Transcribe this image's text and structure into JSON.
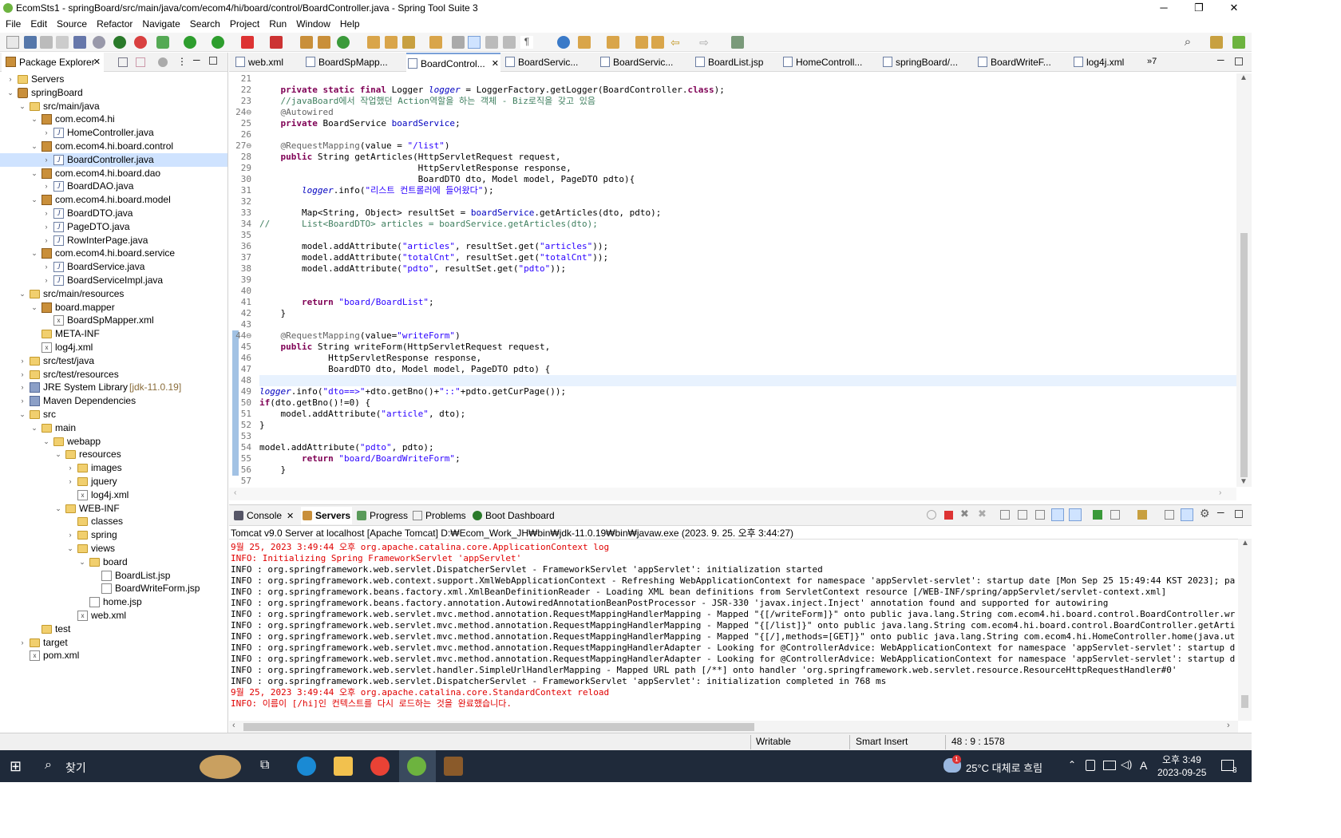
{
  "window": {
    "title": "EcomSts1 - springBoard/src/main/java/com/ecom4/hi/board/control/BoardController.java - Spring Tool Suite 3",
    "minimize": "─",
    "maximize": "❐",
    "close": "✕"
  },
  "menu": [
    "File",
    "Edit",
    "Source",
    "Refactor",
    "Navigate",
    "Search",
    "Project",
    "Run",
    "Window",
    "Help"
  ],
  "package_explorer": {
    "tab_label": "Package Explorer",
    "items": [
      {
        "label": "Servers",
        "icon": "folder",
        "depth": 0,
        "arrow": "›"
      },
      {
        "label": "springBoard",
        "icon": "project",
        "depth": 0,
        "arrow": "⌄"
      },
      {
        "label": "src/main/java",
        "icon": "source-folder",
        "depth": 1,
        "arrow": "⌄"
      },
      {
        "label": "com.ecom4.hi",
        "icon": "package",
        "depth": 2,
        "arrow": "⌄"
      },
      {
        "label": "HomeController.java",
        "icon": "java-file",
        "depth": 3,
        "arrow": "›"
      },
      {
        "label": "com.ecom4.hi.board.control",
        "icon": "package",
        "depth": 2,
        "arrow": "⌄"
      },
      {
        "label": "BoardController.java",
        "icon": "java-file",
        "depth": 3,
        "arrow": "›",
        "selected": true
      },
      {
        "label": "com.ecom4.hi.board.dao",
        "icon": "package",
        "depth": 2,
        "arrow": "⌄"
      },
      {
        "label": "BoardDAO.java",
        "icon": "java-file",
        "depth": 3,
        "arrow": "›"
      },
      {
        "label": "com.ecom4.hi.board.model",
        "icon": "package",
        "depth": 2,
        "arrow": "⌄"
      },
      {
        "label": "BoardDTO.java",
        "icon": "java-file",
        "depth": 3,
        "arrow": "›"
      },
      {
        "label": "PageDTO.java",
        "icon": "java-file",
        "depth": 3,
        "arrow": "›"
      },
      {
        "label": "RowInterPage.java",
        "icon": "java-file",
        "depth": 3,
        "arrow": "›"
      },
      {
        "label": "com.ecom4.hi.board.service",
        "icon": "package",
        "depth": 2,
        "arrow": "⌄"
      },
      {
        "label": "BoardService.java",
        "icon": "java-file",
        "depth": 3,
        "arrow": "›"
      },
      {
        "label": "BoardServiceImpl.java",
        "icon": "java-file",
        "depth": 3,
        "arrow": "›"
      },
      {
        "label": "src/main/resources",
        "icon": "source-folder",
        "depth": 1,
        "arrow": "⌄"
      },
      {
        "label": "board.mapper",
        "icon": "package",
        "depth": 2,
        "arrow": "⌄"
      },
      {
        "label": "BoardSpMapper.xml",
        "icon": "xml-file",
        "depth": 3,
        "arrow": ""
      },
      {
        "label": "META-INF",
        "icon": "folder",
        "depth": 2,
        "arrow": ""
      },
      {
        "label": "log4j.xml",
        "icon": "xml-file",
        "depth": 2,
        "arrow": ""
      },
      {
        "label": "src/test/java",
        "icon": "source-folder",
        "depth": 1,
        "arrow": "›"
      },
      {
        "label": "src/test/resources",
        "icon": "source-folder",
        "depth": 1,
        "arrow": "›"
      },
      {
        "label": "JRE System Library",
        "suffix": "[jdk-11.0.19]",
        "icon": "library",
        "depth": 1,
        "arrow": "›"
      },
      {
        "label": "Maven Dependencies",
        "icon": "library",
        "depth": 1,
        "arrow": "›"
      },
      {
        "label": "src",
        "icon": "folder",
        "depth": 1,
        "arrow": "⌄"
      },
      {
        "label": "main",
        "icon": "folder",
        "depth": 2,
        "arrow": "⌄"
      },
      {
        "label": "webapp",
        "icon": "folder",
        "depth": 3,
        "arrow": "⌄"
      },
      {
        "label": "resources",
        "icon": "folder",
        "depth": 4,
        "arrow": "⌄"
      },
      {
        "label": "images",
        "icon": "folder",
        "depth": 5,
        "arrow": "›"
      },
      {
        "label": "jquery",
        "icon": "folder",
        "depth": 5,
        "arrow": "›"
      },
      {
        "label": "log4j.xml",
        "icon": "xml-file",
        "depth": 5,
        "arrow": ""
      },
      {
        "label": "WEB-INF",
        "icon": "folder",
        "depth": 4,
        "arrow": "⌄"
      },
      {
        "label": "classes",
        "icon": "folder",
        "depth": 5,
        "arrow": ""
      },
      {
        "label": "spring",
        "icon": "folder",
        "depth": 5,
        "arrow": "›"
      },
      {
        "label": "views",
        "icon": "folder",
        "depth": 5,
        "arrow": "⌄"
      },
      {
        "label": "board",
        "icon": "folder",
        "depth": 6,
        "arrow": "⌄"
      },
      {
        "label": "BoardList.jsp",
        "icon": "jsp-file",
        "depth": 7,
        "arrow": ""
      },
      {
        "label": "BoardWriteForm.jsp",
        "icon": "jsp-file",
        "depth": 7,
        "arrow": ""
      },
      {
        "label": "home.jsp",
        "icon": "jsp-file",
        "depth": 6,
        "arrow": ""
      },
      {
        "label": "web.xml",
        "icon": "xml-file",
        "depth": 5,
        "arrow": ""
      },
      {
        "label": "test",
        "icon": "folder",
        "depth": 2,
        "arrow": ""
      },
      {
        "label": "target",
        "icon": "folder",
        "depth": 1,
        "arrow": "›"
      },
      {
        "label": "pom.xml",
        "icon": "xml-file",
        "depth": 1,
        "arrow": ""
      }
    ]
  },
  "editor": {
    "tabs": [
      {
        "label": "web.xml"
      },
      {
        "label": "BoardSpMapp..."
      },
      {
        "label": "BoardControl...",
        "active": true
      },
      {
        "label": "BoardServic..."
      },
      {
        "label": "BoardServic..."
      },
      {
        "label": "BoardList.jsp"
      },
      {
        "label": "HomeControll..."
      },
      {
        "label": "springBoard/..."
      },
      {
        "label": "BoardWriteF..."
      },
      {
        "label": "log4j.xml"
      }
    ],
    "overflow": "»7",
    "lines": [
      {
        "n": "21",
        "t": ""
      },
      {
        "n": "22",
        "t": "    private static final Logger logger = LoggerFactory.getLogger(BoardController.class);"
      },
      {
        "n": "23",
        "t": "    //javaBoard에서 작업했던 Action역할을 하는 객체 - Biz로직을 갖고 있음"
      },
      {
        "n": "24⊖",
        "t": "    @Autowired"
      },
      {
        "n": "25",
        "t": "    private BoardService boardService;"
      },
      {
        "n": "26",
        "t": ""
      },
      {
        "n": "27⊖",
        "t": "    @RequestMapping(value = \"/list\")"
      },
      {
        "n": "28",
        "t": "    public String getArticles(HttpServletRequest request,"
      },
      {
        "n": "29",
        "t": "                              HttpServletResponse response,"
      },
      {
        "n": "30",
        "t": "                              BoardDTO dto, Model model, PageDTO pdto){"
      },
      {
        "n": "31",
        "t": "        logger.info(\"리스트 컨트롤러에 들어왔다\");"
      },
      {
        "n": "32",
        "t": ""
      },
      {
        "n": "33",
        "t": "        Map<String, Object> resultSet = boardService.getArticles(dto, pdto);"
      },
      {
        "n": "34",
        "t": "//      List<BoardDTO> articles = boardService.getArticles(dto);"
      },
      {
        "n": "35",
        "t": ""
      },
      {
        "n": "36",
        "t": "        model.addAttribute(\"articles\", resultSet.get(\"articles\"));"
      },
      {
        "n": "37",
        "t": "        model.addAttribute(\"totalCnt\", resultSet.get(\"totalCnt\"));"
      },
      {
        "n": "38",
        "t": "        model.addAttribute(\"pdto\", resultSet.get(\"pdto\"));"
      },
      {
        "n": "39",
        "t": ""
      },
      {
        "n": "40",
        "t": ""
      },
      {
        "n": "41",
        "t": "        return \"board/BoardList\";"
      },
      {
        "n": "42",
        "t": "    }"
      },
      {
        "n": "43",
        "t": ""
      },
      {
        "n": "44⊖",
        "t": "    @RequestMapping(value=\"writeForm\")"
      },
      {
        "n": "45",
        "t": "    public String writeForm(HttpServletRequest request,"
      },
      {
        "n": "46",
        "t": "             HttpServletResponse response,"
      },
      {
        "n": "47",
        "t": "             BoardDTO dto, Model model, PageDTO pdto) {"
      },
      {
        "n": "48",
        "t": ""
      },
      {
        "n": "49",
        "t": "logger.info(\"dto==>\"+dto.getBno()+\"::\"+pdto.getCurPage());"
      },
      {
        "n": "50",
        "t": "if(dto.getBno()!=0) {"
      },
      {
        "n": "51",
        "t": "    model.addAttribute(\"article\", dto);"
      },
      {
        "n": "52",
        "t": "}"
      },
      {
        "n": "53",
        "t": ""
      },
      {
        "n": "54",
        "t": "model.addAttribute(\"pdto\", pdto);"
      },
      {
        "n": "55",
        "t": "        return \"board/BoardWriteForm\";"
      },
      {
        "n": "56",
        "t": "    }"
      },
      {
        "n": "57",
        "t": ""
      }
    ]
  },
  "bottom": {
    "tabs": [
      {
        "label": "Console"
      },
      {
        "label": "Servers",
        "active": true
      },
      {
        "label": "Progress"
      },
      {
        "label": "Problems"
      },
      {
        "label": "Boot Dashboard"
      }
    ],
    "launch": "Tomcat v9.0 Server at localhost [Apache Tomcat] D:₩Ecom_Work_JH₩bin₩jdk-11.0.19₩bin₩javaw.exe  (2023. 9. 25. 오후 3:44:27)",
    "console": [
      {
        "t": "9월 25, 2023 3:49:44 오후 org.apache.catalina.core.ApplicationContext log",
        "red": true
      },
      {
        "t": "INFO: Initializing Spring FrameworkServlet 'appServlet'",
        "red": true
      },
      {
        "t": "INFO : org.springframework.web.servlet.DispatcherServlet - FrameworkServlet 'appServlet': initialization started",
        "red": false
      },
      {
        "t": "INFO : org.springframework.web.context.support.XmlWebApplicationContext - Refreshing WebApplicationContext for namespace 'appServlet-servlet': startup date [Mon Sep 25 15:49:44 KST 2023]; paren",
        "red": false
      },
      {
        "t": "INFO : org.springframework.beans.factory.xml.XmlBeanDefinitionReader - Loading XML bean definitions from ServletContext resource [/WEB-INF/spring/appServlet/servlet-context.xml]",
        "red": false
      },
      {
        "t": "INFO : org.springframework.beans.factory.annotation.AutowiredAnnotationBeanPostProcessor - JSR-330 'javax.inject.Inject' annotation found and supported for autowiring",
        "red": false
      },
      {
        "t": "INFO : org.springframework.web.servlet.mvc.method.annotation.RequestMappingHandlerMapping - Mapped \"{[/writeForm]}\" onto public java.lang.String com.ecom4.hi.board.control.BoardController.write",
        "red": false
      },
      {
        "t": "INFO : org.springframework.web.servlet.mvc.method.annotation.RequestMappingHandlerMapping - Mapped \"{[/list]}\" onto public java.lang.String com.ecom4.hi.board.control.BoardController.getArticle",
        "red": false
      },
      {
        "t": "INFO : org.springframework.web.servlet.mvc.method.annotation.RequestMappingHandlerMapping - Mapped \"{[/],methods=[GET]}\" onto public java.lang.String com.ecom4.hi.HomeController.home(java.util.",
        "red": false
      },
      {
        "t": "INFO : org.springframework.web.servlet.mvc.method.annotation.RequestMappingHandlerAdapter - Looking for @ControllerAdvice: WebApplicationContext for namespace 'appServlet-servlet': startup date",
        "red": false
      },
      {
        "t": "INFO : org.springframework.web.servlet.mvc.method.annotation.RequestMappingHandlerAdapter - Looking for @ControllerAdvice: WebApplicationContext for namespace 'appServlet-servlet': startup date",
        "red": false
      },
      {
        "t": "INFO : org.springframework.web.servlet.handler.SimpleUrlHandlerMapping - Mapped URL path [/**] onto handler 'org.springframework.web.servlet.resource.ResourceHttpRequestHandler#0'",
        "red": false
      },
      {
        "t": "INFO : org.springframework.web.servlet.DispatcherServlet - FrameworkServlet 'appServlet': initialization completed in 768 ms",
        "red": false
      },
      {
        "t": "9월 25, 2023 3:49:44 오후 org.apache.catalina.core.StandardContext reload",
        "red": true
      },
      {
        "t": "INFO: 이름이 [/hi]인 컨텍스트를 다시 로드하는 것을 완료했습니다.",
        "red": true
      }
    ]
  },
  "status": {
    "writable": "Writable",
    "insert": "Smart Insert",
    "position": "48 : 9 : 1578"
  },
  "taskbar": {
    "search_placeholder": "찾기",
    "weather": "25°C 대체로 흐림",
    "weather_badge": "1",
    "ime": "A",
    "time": "오후 3:49",
    "date": "2023-09-25",
    "notifications": "3"
  },
  "colors": {
    "keyword": "#7f0055",
    "comment": "#3f7f5f",
    "string": "#2a00ff",
    "annotation": "#646464",
    "field": "#0000c0",
    "console_err": "#e00000",
    "selection": "#cfe3ff",
    "taskbar": "#1f2a3a"
  }
}
